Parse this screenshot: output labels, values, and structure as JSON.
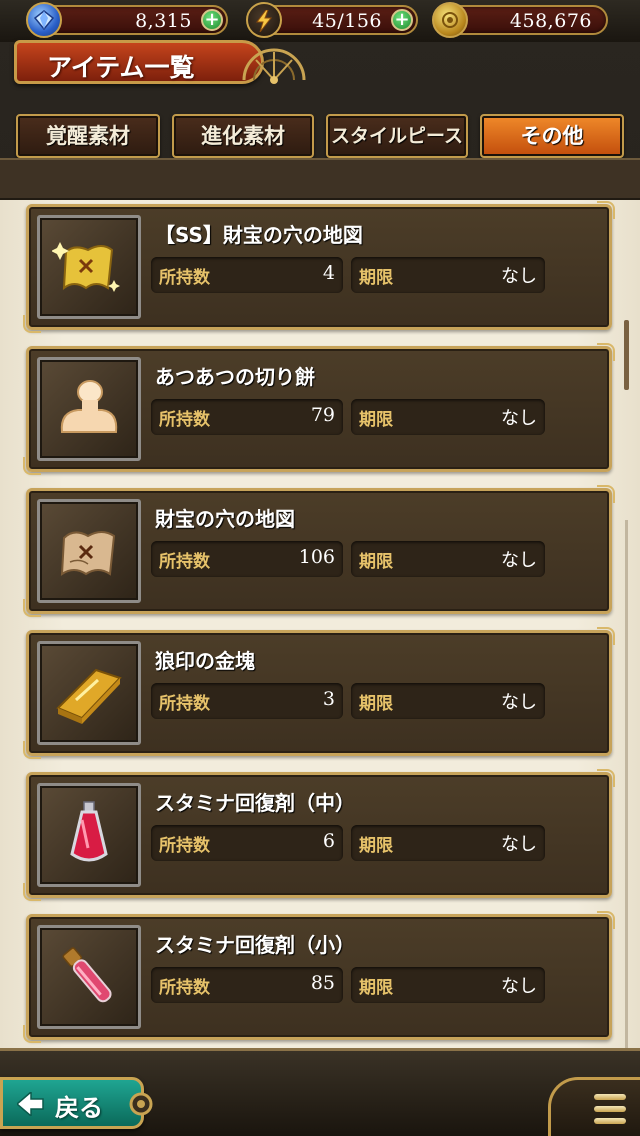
{
  "resources": {
    "gems": "8,315",
    "stamina": "45/156",
    "gold": "458,676",
    "plus_symbol": "+"
  },
  "header": {
    "title": "アイテム一覧"
  },
  "tabs": [
    {
      "label": "覚醒素材",
      "active": false
    },
    {
      "label": "進化素材",
      "active": false
    },
    {
      "label": "スタイルピース",
      "active": false
    },
    {
      "label": "その他",
      "active": true
    }
  ],
  "labels": {
    "quantity": "所持数",
    "expiry": "期限"
  },
  "items": [
    {
      "name": "【SS】財宝の穴の地図",
      "quantity": "4",
      "expiry": "なし",
      "icon": "golden-map-icon"
    },
    {
      "name": "あつあつの切り餅",
      "quantity": "79",
      "expiry": "なし",
      "icon": "mochi-icon"
    },
    {
      "name": "財宝の穴の地図",
      "quantity": "106",
      "expiry": "なし",
      "icon": "treasure-map-icon"
    },
    {
      "name": "狼印の金塊",
      "quantity": "3",
      "expiry": "なし",
      "icon": "gold-bar-icon"
    },
    {
      "name": "スタミナ回復剤（中）",
      "quantity": "6",
      "expiry": "なし",
      "icon": "stamina-potion-medium-icon"
    },
    {
      "name": "スタミナ回復剤（小）",
      "quantity": "85",
      "expiry": "なし",
      "icon": "stamina-potion-small-icon"
    }
  ],
  "footer": {
    "back_label": "戻る"
  },
  "colors": {
    "accent_gold": "#c7a35a",
    "active_tab": "#f08a2a",
    "label_gold": "#e6c26a",
    "back_button": "#1fa592"
  }
}
